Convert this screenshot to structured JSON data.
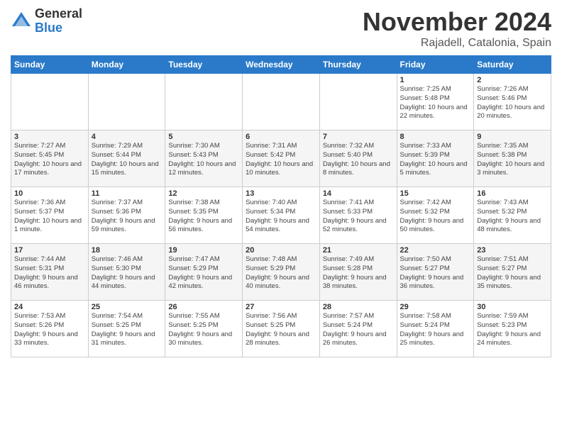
{
  "logo": {
    "general": "General",
    "blue": "Blue"
  },
  "header": {
    "month": "November 2024",
    "location": "Rajadell, Catalonia, Spain"
  },
  "weekdays": [
    "Sunday",
    "Monday",
    "Tuesday",
    "Wednesday",
    "Thursday",
    "Friday",
    "Saturday"
  ],
  "weeks": [
    [
      {
        "day": "",
        "info": ""
      },
      {
        "day": "",
        "info": ""
      },
      {
        "day": "",
        "info": ""
      },
      {
        "day": "",
        "info": ""
      },
      {
        "day": "",
        "info": ""
      },
      {
        "day": "1",
        "info": "Sunrise: 7:25 AM\nSunset: 5:48 PM\nDaylight: 10 hours and 22 minutes."
      },
      {
        "day": "2",
        "info": "Sunrise: 7:26 AM\nSunset: 5:46 PM\nDaylight: 10 hours and 20 minutes."
      }
    ],
    [
      {
        "day": "3",
        "info": "Sunrise: 7:27 AM\nSunset: 5:45 PM\nDaylight: 10 hours and 17 minutes."
      },
      {
        "day": "4",
        "info": "Sunrise: 7:29 AM\nSunset: 5:44 PM\nDaylight: 10 hours and 15 minutes."
      },
      {
        "day": "5",
        "info": "Sunrise: 7:30 AM\nSunset: 5:43 PM\nDaylight: 10 hours and 12 minutes."
      },
      {
        "day": "6",
        "info": "Sunrise: 7:31 AM\nSunset: 5:42 PM\nDaylight: 10 hours and 10 minutes."
      },
      {
        "day": "7",
        "info": "Sunrise: 7:32 AM\nSunset: 5:40 PM\nDaylight: 10 hours and 8 minutes."
      },
      {
        "day": "8",
        "info": "Sunrise: 7:33 AM\nSunset: 5:39 PM\nDaylight: 10 hours and 5 minutes."
      },
      {
        "day": "9",
        "info": "Sunrise: 7:35 AM\nSunset: 5:38 PM\nDaylight: 10 hours and 3 minutes."
      }
    ],
    [
      {
        "day": "10",
        "info": "Sunrise: 7:36 AM\nSunset: 5:37 PM\nDaylight: 10 hours and 1 minute."
      },
      {
        "day": "11",
        "info": "Sunrise: 7:37 AM\nSunset: 5:36 PM\nDaylight: 9 hours and 59 minutes."
      },
      {
        "day": "12",
        "info": "Sunrise: 7:38 AM\nSunset: 5:35 PM\nDaylight: 9 hours and 56 minutes."
      },
      {
        "day": "13",
        "info": "Sunrise: 7:40 AM\nSunset: 5:34 PM\nDaylight: 9 hours and 54 minutes."
      },
      {
        "day": "14",
        "info": "Sunrise: 7:41 AM\nSunset: 5:33 PM\nDaylight: 9 hours and 52 minutes."
      },
      {
        "day": "15",
        "info": "Sunrise: 7:42 AM\nSunset: 5:32 PM\nDaylight: 9 hours and 50 minutes."
      },
      {
        "day": "16",
        "info": "Sunrise: 7:43 AM\nSunset: 5:32 PM\nDaylight: 9 hours and 48 minutes."
      }
    ],
    [
      {
        "day": "17",
        "info": "Sunrise: 7:44 AM\nSunset: 5:31 PM\nDaylight: 9 hours and 46 minutes."
      },
      {
        "day": "18",
        "info": "Sunrise: 7:46 AM\nSunset: 5:30 PM\nDaylight: 9 hours and 44 minutes."
      },
      {
        "day": "19",
        "info": "Sunrise: 7:47 AM\nSunset: 5:29 PM\nDaylight: 9 hours and 42 minutes."
      },
      {
        "day": "20",
        "info": "Sunrise: 7:48 AM\nSunset: 5:29 PM\nDaylight: 9 hours and 40 minutes."
      },
      {
        "day": "21",
        "info": "Sunrise: 7:49 AM\nSunset: 5:28 PM\nDaylight: 9 hours and 38 minutes."
      },
      {
        "day": "22",
        "info": "Sunrise: 7:50 AM\nSunset: 5:27 PM\nDaylight: 9 hours and 36 minutes."
      },
      {
        "day": "23",
        "info": "Sunrise: 7:51 AM\nSunset: 5:27 PM\nDaylight: 9 hours and 35 minutes."
      }
    ],
    [
      {
        "day": "24",
        "info": "Sunrise: 7:53 AM\nSunset: 5:26 PM\nDaylight: 9 hours and 33 minutes."
      },
      {
        "day": "25",
        "info": "Sunrise: 7:54 AM\nSunset: 5:25 PM\nDaylight: 9 hours and 31 minutes."
      },
      {
        "day": "26",
        "info": "Sunrise: 7:55 AM\nSunset: 5:25 PM\nDaylight: 9 hours and 30 minutes."
      },
      {
        "day": "27",
        "info": "Sunrise: 7:56 AM\nSunset: 5:25 PM\nDaylight: 9 hours and 28 minutes."
      },
      {
        "day": "28",
        "info": "Sunrise: 7:57 AM\nSunset: 5:24 PM\nDaylight: 9 hours and 26 minutes."
      },
      {
        "day": "29",
        "info": "Sunrise: 7:58 AM\nSunset: 5:24 PM\nDaylight: 9 hours and 25 minutes."
      },
      {
        "day": "30",
        "info": "Sunrise: 7:59 AM\nSunset: 5:23 PM\nDaylight: 9 hours and 24 minutes."
      }
    ]
  ]
}
